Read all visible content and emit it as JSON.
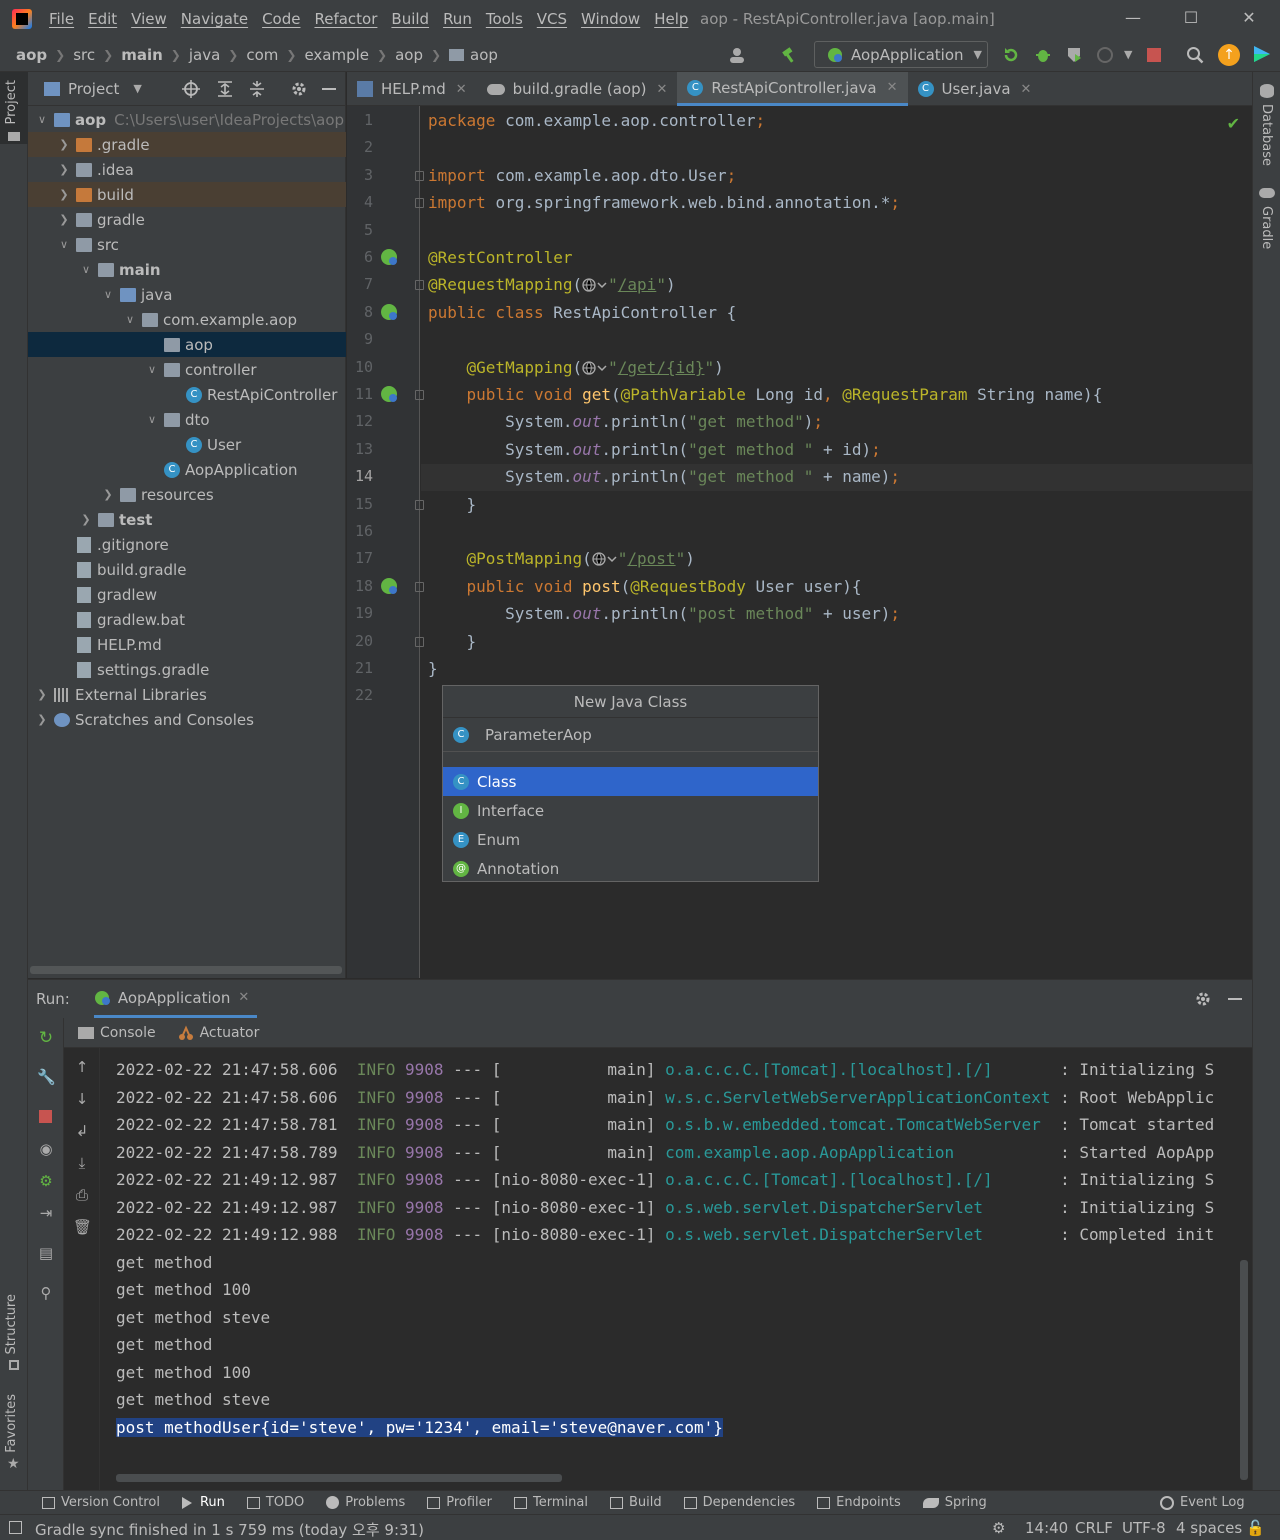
{
  "window": {
    "title": "aop - RestApiController.java [aop.main]",
    "menu": [
      "File",
      "Edit",
      "View",
      "Navigate",
      "Code",
      "Refactor",
      "Build",
      "Run",
      "Tools",
      "VCS",
      "Window",
      "Help"
    ]
  },
  "breadcrumb": [
    "aop",
    "src",
    "main",
    "java",
    "com",
    "example",
    "aop",
    "aop"
  ],
  "toolbar": {
    "run_config": "AopApplication"
  },
  "left_strip": {
    "top": "Project",
    "bottom1": "Structure",
    "bottom2": "Favorites"
  },
  "right_strip": {
    "top": "Database",
    "bottom": "Gradle"
  },
  "project": {
    "title": "Project",
    "tree": [
      {
        "label": "aop",
        "path": "C:\\Users\\user\\IdeaProjects\\aop",
        "depth": 0,
        "arrow": "v",
        "kind": "module",
        "bold": true
      },
      {
        "label": ".gradle",
        "depth": 1,
        "arrow": ">",
        "kind": "folder-orange",
        "hl": "orange"
      },
      {
        "label": ".idea",
        "depth": 1,
        "arrow": ">",
        "kind": "folder"
      },
      {
        "label": "build",
        "depth": 1,
        "arrow": ">",
        "kind": "folder-orange",
        "hl": "orange"
      },
      {
        "label": "gradle",
        "depth": 1,
        "arrow": ">",
        "kind": "folder"
      },
      {
        "label": "src",
        "depth": 1,
        "arrow": "v",
        "kind": "folder"
      },
      {
        "label": "main",
        "depth": 2,
        "arrow": "v",
        "kind": "folder",
        "bold": true
      },
      {
        "label": "java",
        "depth": 3,
        "arrow": "v",
        "kind": "folder-blue"
      },
      {
        "label": "com.example.aop",
        "depth": 4,
        "arrow": "v",
        "kind": "folder"
      },
      {
        "label": "aop",
        "depth": 5,
        "arrow": "",
        "kind": "folder",
        "hl": "selected"
      },
      {
        "label": "controller",
        "depth": 5,
        "arrow": "v",
        "kind": "folder"
      },
      {
        "label": "RestApiController",
        "depth": 6,
        "arrow": "",
        "kind": "class"
      },
      {
        "label": "dto",
        "depth": 5,
        "arrow": "v",
        "kind": "folder"
      },
      {
        "label": "User",
        "depth": 6,
        "arrow": "",
        "kind": "class"
      },
      {
        "label": "AopApplication",
        "depth": 5,
        "arrow": "",
        "kind": "class"
      },
      {
        "label": "resources",
        "depth": 3,
        "arrow": ">",
        "kind": "folder"
      },
      {
        "label": "test",
        "depth": 2,
        "arrow": ">",
        "kind": "folder",
        "bold": true
      },
      {
        "label": ".gitignore",
        "depth": 1,
        "arrow": "",
        "kind": "file"
      },
      {
        "label": "build.gradle",
        "depth": 1,
        "arrow": "",
        "kind": "file"
      },
      {
        "label": "gradlew",
        "depth": 1,
        "arrow": "",
        "kind": "file"
      },
      {
        "label": "gradlew.bat",
        "depth": 1,
        "arrow": "",
        "kind": "file"
      },
      {
        "label": "HELP.md",
        "depth": 1,
        "arrow": "",
        "kind": "file"
      },
      {
        "label": "settings.gradle",
        "depth": 1,
        "arrow": "",
        "kind": "file"
      },
      {
        "label": "External Libraries",
        "depth": 0,
        "arrow": ">",
        "kind": "libs"
      },
      {
        "label": "Scratches and Consoles",
        "depth": 0,
        "arrow": ">",
        "kind": "scratch"
      }
    ]
  },
  "editor_tabs": [
    {
      "label": "HELP.md",
      "active": false
    },
    {
      "label": "build.gradle (aop)",
      "active": false
    },
    {
      "label": "RestApiController.java",
      "active": true
    },
    {
      "label": "User.java",
      "active": false
    }
  ],
  "editor": {
    "current_line": 14,
    "lines": [
      [
        {
          "t": "package ",
          "c": "kw"
        },
        {
          "t": "com.example.aop.controller",
          "c": ""
        },
        {
          "t": ";",
          "c": "kw"
        }
      ],
      [],
      [
        {
          "t": "import ",
          "c": "kw"
        },
        {
          "t": "com.example.aop.dto.User",
          "c": ""
        },
        {
          "t": ";",
          "c": "kw"
        }
      ],
      [
        {
          "t": "import ",
          "c": "kw"
        },
        {
          "t": "org.springframework.web.bind.annotation.*",
          "c": ""
        },
        {
          "t": ";",
          "c": "kw"
        }
      ],
      [],
      [
        {
          "t": "@RestController",
          "c": "ann"
        }
      ],
      [
        {
          "t": "@RequestMapping",
          "c": "ann"
        },
        {
          "t": "(",
          "c": ""
        },
        {
          "t": "[badge]",
          "c": "badge"
        },
        {
          "t": "\"",
          "c": "str"
        },
        {
          "t": "/api",
          "c": "url"
        },
        {
          "t": "\"",
          "c": "str"
        },
        {
          "t": ")",
          "c": ""
        }
      ],
      [
        {
          "t": "public class ",
          "c": "kw"
        },
        {
          "t": "RestApiController {",
          "c": ""
        }
      ],
      [],
      [
        {
          "t": "    ",
          "c": ""
        },
        {
          "t": "@GetMapping",
          "c": "ann"
        },
        {
          "t": "(",
          "c": ""
        },
        {
          "t": "[badge]",
          "c": "badge"
        },
        {
          "t": "\"",
          "c": "str"
        },
        {
          "t": "/get/{id}",
          "c": "url"
        },
        {
          "t": "\"",
          "c": "str"
        },
        {
          "t": ")",
          "c": ""
        }
      ],
      [
        {
          "t": "    ",
          "c": ""
        },
        {
          "t": "public void ",
          "c": "kw"
        },
        {
          "t": "get",
          "c": "fn"
        },
        {
          "t": "(",
          "c": ""
        },
        {
          "t": "@PathVariable ",
          "c": "ann"
        },
        {
          "t": "Long id",
          "c": ""
        },
        {
          "t": ", ",
          "c": "kw"
        },
        {
          "t": "@RequestParam ",
          "c": "ann"
        },
        {
          "t": "String name){",
          "c": ""
        }
      ],
      [
        {
          "t": "        System.",
          "c": ""
        },
        {
          "t": "out",
          "c": "field"
        },
        {
          "t": ".println(",
          "c": ""
        },
        {
          "t": "\"get method\"",
          "c": "str"
        },
        {
          "t": ")",
          "c": ""
        },
        {
          "t": ";",
          "c": "kw"
        }
      ],
      [
        {
          "t": "        System.",
          "c": ""
        },
        {
          "t": "out",
          "c": "field"
        },
        {
          "t": ".println(",
          "c": ""
        },
        {
          "t": "\"get method \"",
          "c": "str"
        },
        {
          "t": " + id)",
          "c": ""
        },
        {
          "t": ";",
          "c": "kw"
        }
      ],
      [
        {
          "t": "        System.",
          "c": ""
        },
        {
          "t": "out",
          "c": "field"
        },
        {
          "t": ".println(",
          "c": ""
        },
        {
          "t": "\"get method \"",
          "c": "str"
        },
        {
          "t": " + name)",
          "c": ""
        },
        {
          "t": ";",
          "c": "kw"
        }
      ],
      [
        {
          "t": "    }",
          "c": ""
        }
      ],
      [],
      [
        {
          "t": "    ",
          "c": ""
        },
        {
          "t": "@PostMapping",
          "c": "ann"
        },
        {
          "t": "(",
          "c": ""
        },
        {
          "t": "[badge]",
          "c": "badge"
        },
        {
          "t": "\"",
          "c": "str"
        },
        {
          "t": "/post",
          "c": "url"
        },
        {
          "t": "\"",
          "c": "str"
        },
        {
          "t": ")",
          "c": ""
        }
      ],
      [
        {
          "t": "    ",
          "c": ""
        },
        {
          "t": "public void ",
          "c": "kw"
        },
        {
          "t": "post",
          "c": "fn"
        },
        {
          "t": "(",
          "c": ""
        },
        {
          "t": "@RequestBody ",
          "c": "ann"
        },
        {
          "t": "User user){",
          "c": ""
        }
      ],
      [
        {
          "t": "        System.",
          "c": ""
        },
        {
          "t": "out",
          "c": "field"
        },
        {
          "t": ".println(",
          "c": ""
        },
        {
          "t": "\"post method\"",
          "c": "str"
        },
        {
          "t": " + user)",
          "c": ""
        },
        {
          "t": ";",
          "c": "kw"
        }
      ],
      [
        {
          "t": "    }",
          "c": ""
        }
      ],
      [
        {
          "t": "}",
          "c": ""
        }
      ],
      []
    ]
  },
  "popup": {
    "title": "New Java Class",
    "input_value": "ParameterAop",
    "options": [
      {
        "label": "Class",
        "letter": "C",
        "color": "#3592c4",
        "selected": true
      },
      {
        "label": "Interface",
        "letter": "I",
        "color": "#62b543",
        "selected": false
      },
      {
        "label": "Enum",
        "letter": "E",
        "color": "#3592c4",
        "selected": false
      },
      {
        "label": "Annotation",
        "letter": "@",
        "color": "#62b543",
        "selected": false
      }
    ]
  },
  "run_panel": {
    "label": "Run:",
    "tab": "AopApplication",
    "subtabs": [
      "Console",
      "Actuator"
    ],
    "log_lines": [
      {
        "ts": "2022-02-22 21:47:58.606",
        "level": "INFO",
        "pid": "9908",
        "sep": "---",
        "thread": "[           main]",
        "logger": "o.a.c.c.C.[Tomcat].[localhost].[/]      ",
        "msg": ": Initializing S"
      },
      {
        "ts": "2022-02-22 21:47:58.606",
        "level": "INFO",
        "pid": "9908",
        "sep": "---",
        "thread": "[           main]",
        "logger": "w.s.c.ServletWebServerApplicationContext",
        "msg": ": Root WebApplic"
      },
      {
        "ts": "2022-02-22 21:47:58.781",
        "level": "INFO",
        "pid": "9908",
        "sep": "---",
        "thread": "[           main]",
        "logger": "o.s.b.w.embedded.tomcat.TomcatWebServer ",
        "msg": ": Tomcat started"
      },
      {
        "ts": "2022-02-22 21:47:58.789",
        "level": "INFO",
        "pid": "9908",
        "sep": "---",
        "thread": "[           main]",
        "logger": "com.example.aop.AopApplication          ",
        "msg": ": Started AopApp"
      },
      {
        "ts": "2022-02-22 21:49:12.987",
        "level": "INFO",
        "pid": "9908",
        "sep": "---",
        "thread": "[nio-8080-exec-1]",
        "logger": "o.a.c.c.C.[Tomcat].[localhost].[/]      ",
        "msg": ": Initializing S"
      },
      {
        "ts": "2022-02-22 21:49:12.987",
        "level": "INFO",
        "pid": "9908",
        "sep": "---",
        "thread": "[nio-8080-exec-1]",
        "logger": "o.s.web.servlet.DispatcherServlet       ",
        "msg": ": Initializing S"
      },
      {
        "ts": "2022-02-22 21:49:12.988",
        "level": "INFO",
        "pid": "9908",
        "sep": "---",
        "thread": "[nio-8080-exec-1]",
        "logger": "o.s.web.servlet.DispatcherServlet       ",
        "msg": ": Completed init"
      }
    ],
    "output_lines": [
      "get method",
      "get method 100",
      "get method steve",
      "get method",
      "get method 100",
      "get method steve"
    ],
    "selected_line": "post methodUser{id='steve', pw='1234', email='steve@naver.com'}"
  },
  "bottom_tabs": [
    {
      "label": "Version Control",
      "active": false
    },
    {
      "label": "Run",
      "active": true
    },
    {
      "label": "TODO",
      "active": false
    },
    {
      "label": "Problems",
      "active": false
    },
    {
      "label": "Profiler",
      "active": false
    },
    {
      "label": "Terminal",
      "active": false
    },
    {
      "label": "Build",
      "active": false
    },
    {
      "label": "Dependencies",
      "active": false
    },
    {
      "label": "Endpoints",
      "active": false
    },
    {
      "label": "Spring",
      "active": false
    }
  ],
  "event_log": "Event Log",
  "status": {
    "message": "Gradle sync finished in 1 s 759 ms (today 오후 9:31)",
    "position": "14:40",
    "line_sep": "CRLF",
    "encoding": "UTF-8",
    "indent": "4 spaces"
  }
}
